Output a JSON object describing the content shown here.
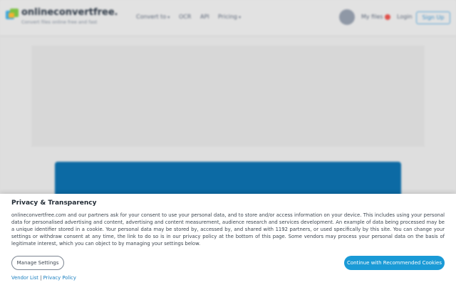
{
  "header": {
    "logo_text": "onlineconvertfree.c",
    "tagline": "Convert files online free and fast",
    "nav": [
      {
        "label": "Convert to",
        "caret": "▾"
      },
      {
        "label": "OCR",
        "caret": ""
      },
      {
        "label": "API",
        "caret": ""
      },
      {
        "label": "Pricing",
        "caret": "▾"
      }
    ],
    "my_files_label": "My files",
    "login_label": "Login",
    "signup_label": "Sign Up"
  },
  "consent": {
    "title": "Privacy & Transparency",
    "body": "onlineconvertfree.com and our partners ask for your consent to use your personal data, and to store and/or access information on your device. This includes using your personal data for personalised advertising and content, advertising and content measurement, audience research and services development. An example of data being processed may be a unique identifier stored in a cookie. Your personal data may be stored by, accessed by, and shared with 1192 partners, or used specifically by this site. You can change your settings or withdraw consent at any time, the link to do so is in our privacy policy at the bottom of this page. Some vendors may process your personal data on the basis of legitimate interest, which you can object to by managing your settings below.",
    "manage_label": "Manage Settings",
    "continue_label": "Continue with Recommended Cookies",
    "vendor_list_label": "Vendor List",
    "separator": "|",
    "privacy_policy_label": "Privacy Policy"
  },
  "colors": {
    "accent": "#1a9ad6",
    "hero": "#0c6aa4",
    "badge": "#e0504a"
  },
  "icons": [
    "logo-icon",
    "user-avatar-icon",
    "chevron-down-icon"
  ]
}
